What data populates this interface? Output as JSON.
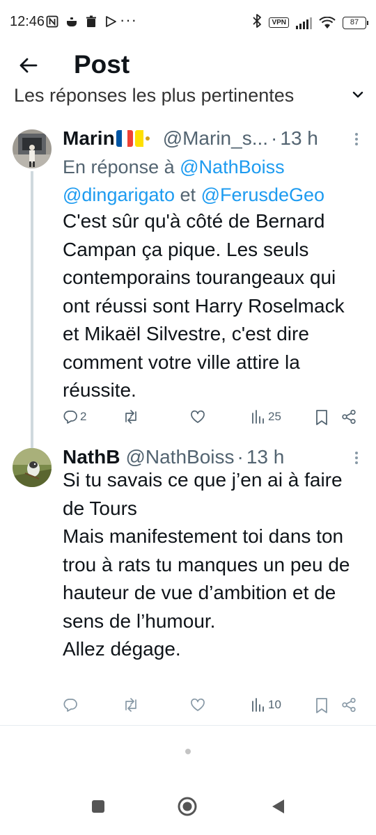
{
  "status_bar": {
    "time": "12:46",
    "more": "···",
    "vpn": "VPN",
    "battery": "87",
    "icons": [
      "n-icon",
      "cooking-pot-icon",
      "trash-icon",
      "play-store-icon",
      "bluetooth-icon",
      "vpn-icon",
      "signal-icon",
      "wifi-icon",
      "battery-icon"
    ]
  },
  "header": {
    "title": "Post",
    "back_icon": "arrow-left-icon"
  },
  "sort": {
    "label": "Les réponses les plus pertinentes",
    "icon": "chevron-down-icon"
  },
  "tweets": [
    {
      "name": "Marin",
      "flags": [
        "france-flag",
        "vatican-flag"
      ],
      "handle": "@Marin_s...",
      "dot": "·",
      "time": "13 h",
      "reply_prefix": "En réponse à",
      "reply_mention_1": "@NathBoiss",
      "reply_mention_2": "@dingarigato",
      "reply_and": "et",
      "reply_mention_3": "@FerusdeGeo",
      "body": "C'est sûr qu'à côté de Bernard Campan ça pique. Les seuls contemporains tourangeaux qui ont réussi sont Harry Roselmack et Mikaël Silvestre, c'est dire comment votre ville attire la réussite.",
      "replies": "2",
      "retweets": "",
      "likes": "",
      "views": "25"
    },
    {
      "name": "NathB",
      "handle": "@NathBoiss",
      "dot": "·",
      "time": "13 h",
      "body": "Si tu savais ce que j’en ai à faire de Tours\nMais manifestement toi dans ton trou à rats tu manques un peu de hauteur de vue d’ambition et de sens de l’humour.\nAllez dégage.",
      "replies": "",
      "retweets": "",
      "likes": "",
      "views": "10"
    }
  ],
  "colors": {
    "link": "#1d9bf0",
    "secondary_text": "#536471",
    "primary_text": "#0f1419",
    "thread_line": "#cfd9de"
  }
}
